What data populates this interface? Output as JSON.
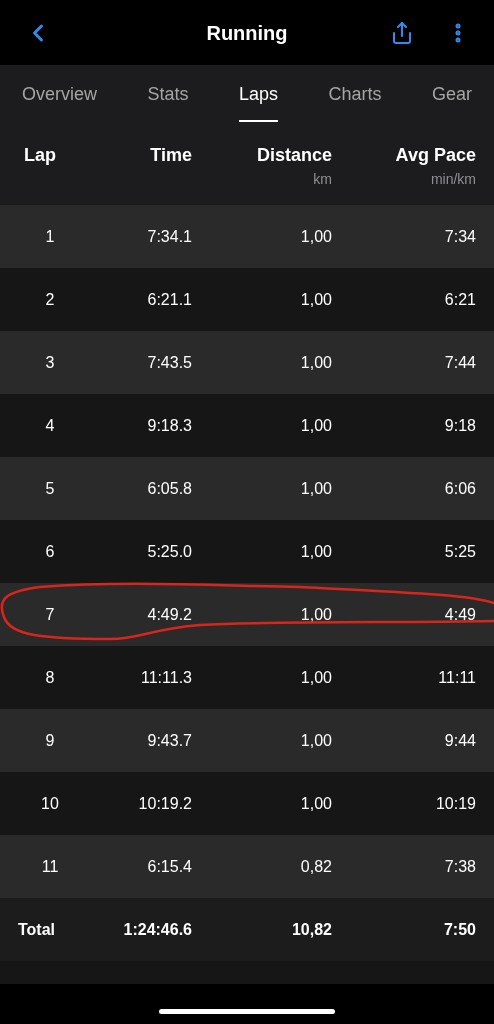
{
  "header": {
    "title": "Running"
  },
  "tabs": [
    {
      "label": "Overview",
      "selected": false
    },
    {
      "label": "Stats",
      "selected": false
    },
    {
      "label": "Laps",
      "selected": true
    },
    {
      "label": "Charts",
      "selected": false
    },
    {
      "label": "Gear",
      "selected": false
    }
  ],
  "table": {
    "columns": [
      {
        "label": "Lap"
      },
      {
        "label": "Time"
      },
      {
        "label": "Distance",
        "unit": "km"
      },
      {
        "label": "Avg Pace",
        "unit": "min/km"
      }
    ],
    "rows": [
      {
        "lap": "1",
        "time": "7:34.1",
        "distance": "1,00",
        "pace": "7:34",
        "circled": false
      },
      {
        "lap": "2",
        "time": "6:21.1",
        "distance": "1,00",
        "pace": "6:21",
        "circled": false
      },
      {
        "lap": "3",
        "time": "7:43.5",
        "distance": "1,00",
        "pace": "7:44",
        "circled": false
      },
      {
        "lap": "4",
        "time": "9:18.3",
        "distance": "1,00",
        "pace": "9:18",
        "circled": false
      },
      {
        "lap": "5",
        "time": "6:05.8",
        "distance": "1,00",
        "pace": "6:06",
        "circled": false
      },
      {
        "lap": "6",
        "time": "5:25.0",
        "distance": "1,00",
        "pace": "5:25",
        "circled": false
      },
      {
        "lap": "7",
        "time": "4:49.2",
        "distance": "1,00",
        "pace": "4:49",
        "circled": true
      },
      {
        "lap": "8",
        "time": "11:11.3",
        "distance": "1,00",
        "pace": "11:11",
        "circled": false
      },
      {
        "lap": "9",
        "time": "9:43.7",
        "distance": "1,00",
        "pace": "9:44",
        "circled": false
      },
      {
        "lap": "10",
        "time": "10:19.2",
        "distance": "1,00",
        "pace": "10:19",
        "circled": false
      },
      {
        "lap": "11",
        "time": "6:15.4",
        "distance": "0,82",
        "pace": "7:38",
        "circled": false
      }
    ],
    "total": {
      "lap": "Total",
      "time": "1:24:46.6",
      "distance": "10,82",
      "pace": "7:50"
    }
  }
}
